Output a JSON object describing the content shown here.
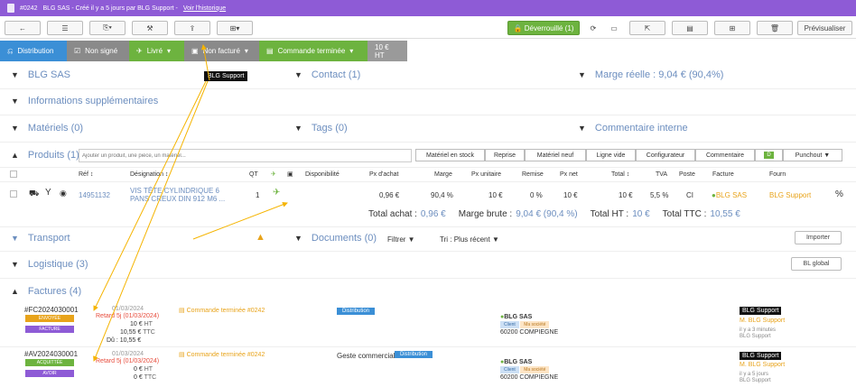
{
  "topbar": {
    "doc_id": "#0242",
    "text": "BLG SAS - Créé il y a 5 jours par BLG Support -",
    "history_link": "Voir l'historique"
  },
  "toolbar": {
    "unlock_label": "Déverrouillé (1)",
    "preview_label": "Prévisualiser"
  },
  "status": [
    {
      "label": "Distribution",
      "color": "#3b8fd6"
    },
    {
      "label": "Non signé",
      "color": "#8a8a8a"
    },
    {
      "label": "Livré",
      "color": "#6db33f"
    },
    {
      "label": "Non facturé",
      "color": "#8a8a8a"
    },
    {
      "label": "Commande terminée",
      "color": "#6db33f"
    },
    {
      "label": "10 € HT",
      "color": "#9a9a9a"
    }
  ],
  "tooltip_top": "BLG Support",
  "sections": {
    "client": "BLG SAS",
    "contact": "Contact (1)",
    "marge": "Marge réelle : 9,04 € (90,4%)",
    "infos": "Informations supplémentaires",
    "materiels": "Matériels (0)",
    "tags": "Tags (0)",
    "commentaire": "Commentaire interne",
    "produits": "Produits (1)",
    "transport": "Transport",
    "documents": "Documents (0)",
    "logistique": "Logistique (3)",
    "factures": "Factures (4)"
  },
  "product_search_placeholder": "Ajouter un produit, une pièce, un matériel...",
  "product_buttons": [
    "Matériel en stock",
    "Reprise",
    "Matériel neuf",
    "Ligne vide",
    "Configurateur",
    "Commentaire",
    "D",
    "Punchout ▼"
  ],
  "table_headers": [
    "Réf ↕",
    "Désignation ↕",
    "QT",
    "Disponibilité",
    "Px d'achat",
    "Marge",
    "Px unitaire",
    "Remise",
    "Px net",
    "Total ↕",
    "TVA",
    "Poste",
    "Facture",
    "Fourn"
  ],
  "row": {
    "ref": "14951132",
    "designation_1": "VIS TÊTE CYLINDRIQUE 6",
    "designation_2": "PANS CREUX DIN 912 M6 ...",
    "qt": "1",
    "px_achat": "0,96 €",
    "marge": "90,4 %",
    "px_unitaire": "10 €",
    "remise": "0 %",
    "px_net": "10 €",
    "total": "10 €",
    "tva": "5,5 %",
    "poste": "CI",
    "facture": "BLG SAS",
    "fourn": "BLG Support",
    "pct": "%"
  },
  "totals": {
    "achat_label": "Total achat :",
    "achat_value": "0,96 €",
    "marge_label": "Marge brute :",
    "marge_value": "9,04 € (90,4 %)",
    "ht_label": "Total HT :",
    "ht_value": "10 €",
    "ttc_label": "Total TTC :",
    "ttc_value": "10,55 €"
  },
  "documents": {
    "filter": "Filtrer ▼",
    "sort": "Tri : Plus récent ▼",
    "import": "Importer"
  },
  "logistique_btn": "BL global",
  "invoices": [
    {
      "num": "#FC2024030001",
      "status": "ENVOYÉE",
      "status_color": "#e8a31a",
      "type": "FACTURE",
      "type_color": "#8e5bd6",
      "date": "01/03/2024",
      "late": "Retard 5j (01/03/2024)",
      "ht": "10 €",
      "ttc": "10,55 €",
      "du": "Dû : 10,55 €",
      "link": "Commande terminée #0242",
      "label_geste": "",
      "tag": "Distribution",
      "client": "BLG SAS",
      "client_tag1": "Client",
      "client_tag2": "Ma société",
      "city": "60200 COMPIEGNE",
      "owner": "BLG Support",
      "owner2": "M. BLG Support",
      "time": "il y a 3 minutes",
      "by": "BLG Support"
    },
    {
      "num": "#AV2024030001",
      "status": "ACQUITTÉE",
      "status_color": "#6db33f",
      "type": "AVOIR",
      "type_color": "#8e5bd6",
      "date": "01/03/2024",
      "late": "Retard 5j (01/03/2024)",
      "ht": "0 €",
      "ttc": "0 €",
      "du": "",
      "link": "Commande terminée #0242",
      "label_geste": "Geste commercial",
      "tag": "Distribution",
      "client": "BLG SAS",
      "client_tag1": "Client",
      "client_tag2": "Ma société",
      "city": "60200 COMPIEGNE",
      "owner": "BLG Support",
      "owner2": "M. BLG Support",
      "time": "il y a 5 jours",
      "by": "BLG Support"
    }
  ],
  "labels": {
    "ht": "HT",
    "ttc": "TTC"
  }
}
